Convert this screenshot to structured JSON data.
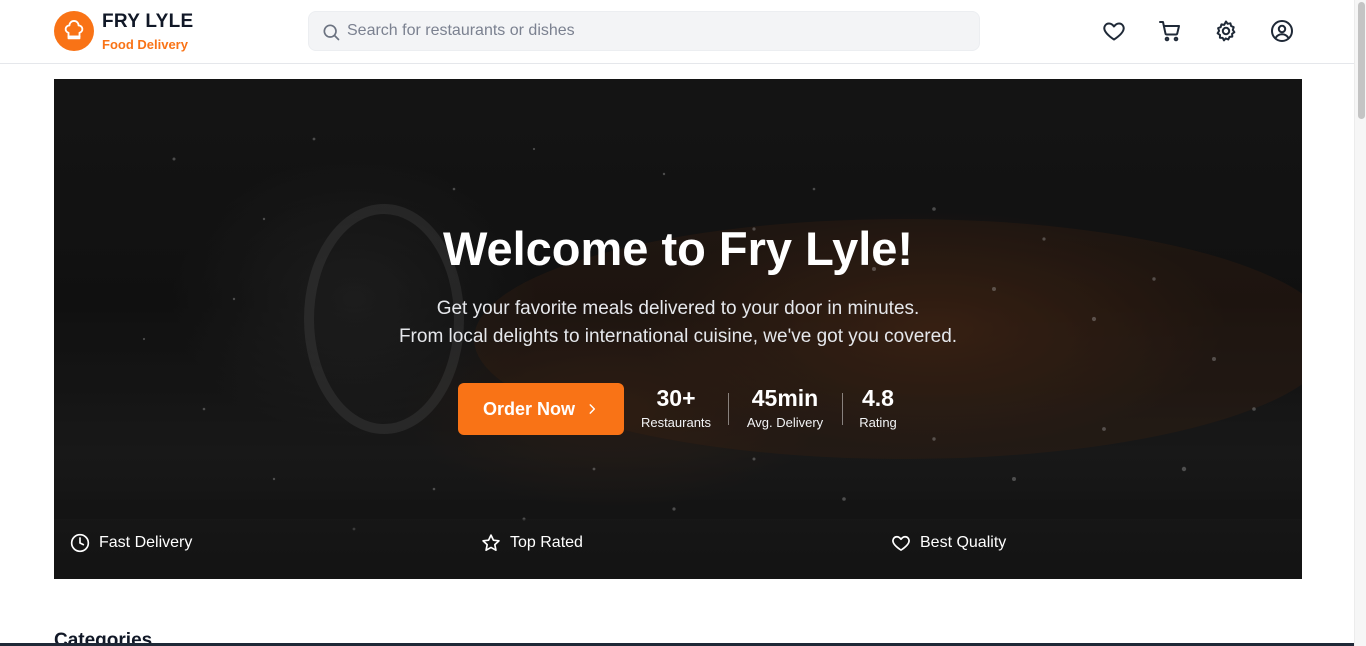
{
  "brand": {
    "name": "FRY LYLE",
    "tagline": "Food Delivery",
    "accent": "#f97316"
  },
  "search": {
    "placeholder": "Search for restaurants or dishes",
    "value": ""
  },
  "nav": {
    "icons": [
      "heart-icon",
      "cart-icon",
      "settings-gear-icon",
      "user-account-icon"
    ]
  },
  "hero": {
    "title": "Welcome to Fry Lyle!",
    "subtitle_line1": "Get your favorite meals delivered to your door in minutes.",
    "subtitle_line2": "From local delights to international cuisine, we've got you covered.",
    "cta": "Order Now",
    "stats": [
      {
        "value": "30+",
        "label": "Restaurants"
      },
      {
        "value": "45min",
        "label": "Avg. Delivery"
      },
      {
        "value": "4.8",
        "label": "Rating"
      }
    ],
    "features": [
      {
        "label": "Fast Delivery",
        "icon": "clock-icon"
      },
      {
        "label": "Top Rated",
        "icon": "star-icon"
      },
      {
        "label": "Best Quality",
        "icon": "heart-icon"
      }
    ]
  },
  "sections": {
    "categories_title": "Categories"
  }
}
